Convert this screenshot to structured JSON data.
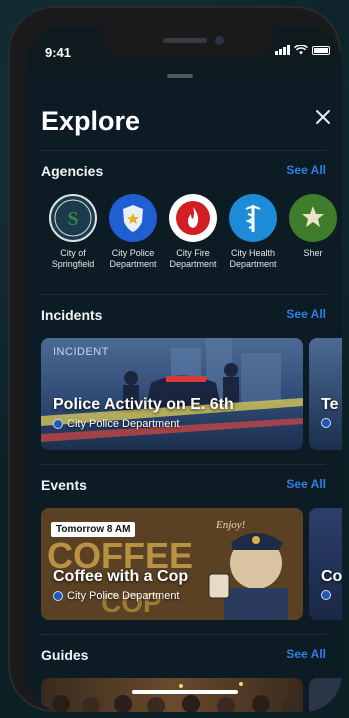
{
  "status_bar": {
    "time": "9:41"
  },
  "sheet": {
    "title": "Explore"
  },
  "agencies": {
    "heading": "Agencies",
    "see_all": "See All",
    "items": [
      {
        "label_line1": "City of",
        "label_line2": "Springfield",
        "icon": "city-seal-icon",
        "color": "#1d3a4a"
      },
      {
        "label_line1": "City Police",
        "label_line2": "Department",
        "icon": "police-badge-icon",
        "color": "#1f5fd1"
      },
      {
        "label_line1": "City Fire",
        "label_line2": "Department",
        "icon": "flame-icon",
        "color": "#ffffff"
      },
      {
        "label_line1": "City Health",
        "label_line2": "Department",
        "icon": "caduceus-icon",
        "color": "#1e8bd9"
      },
      {
        "label_line1": "Sher",
        "label_line2": "",
        "icon": "sheriff-star-icon",
        "color": "#3f7d2c"
      }
    ]
  },
  "incidents": {
    "heading": "Incidents",
    "see_all": "See All",
    "cards": [
      {
        "tag": "INCIDENT",
        "title": "Police Activity on E. 6th",
        "agency": "City Police Department"
      },
      {
        "tag": "",
        "title": "Te",
        "agency": ""
      }
    ]
  },
  "events": {
    "heading": "Events",
    "see_all": "See All",
    "cards": [
      {
        "date_badge": "Tomorrow 8 AM",
        "title": "Coffee with a Cop",
        "agency": "City Police Department",
        "art_word_top": "COFFEE",
        "art_word_bottom": "COP",
        "art_script": "Enjoy!"
      },
      {
        "date_badge": "",
        "title": "Co",
        "agency": ""
      }
    ]
  },
  "guides": {
    "heading": "Guides",
    "see_all": "See All"
  },
  "colors": {
    "accent": "#2f7fe0",
    "sheet_bg": "#0d1b25"
  }
}
